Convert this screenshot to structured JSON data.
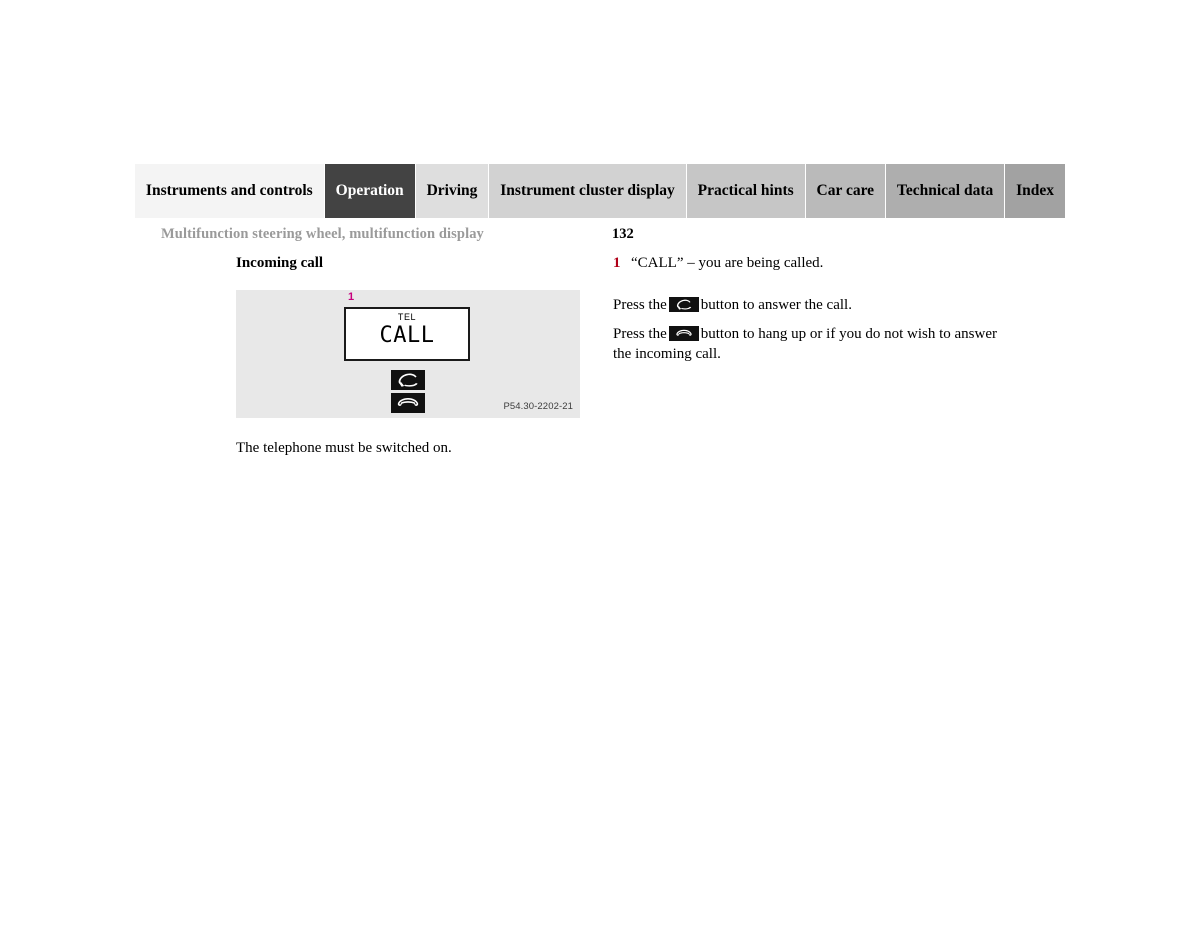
{
  "tabbar": {
    "tabs": [
      {
        "label": "Instruments and controls",
        "active": false,
        "bg": "#f4f4f4",
        "width": 117
      },
      {
        "label": "Operation",
        "active": true,
        "bg": "#434343",
        "width": 118
      },
      {
        "label": "Driving",
        "active": false,
        "bg": "#dedede",
        "width": 117
      },
      {
        "label": "Instrument cluster display",
        "active": false,
        "bg": "#d2d2d2",
        "width": 117
      },
      {
        "label": "Practical hints",
        "active": false,
        "bg": "#c6c6c6",
        "width": 117
      },
      {
        "label": "Car care",
        "active": false,
        "bg": "#bababa",
        "width": 117
      },
      {
        "label": "Technical data",
        "active": false,
        "bg": "#aeaeae",
        "width": 117
      },
      {
        "label": "Index",
        "active": false,
        "bg": "#a2a2a2",
        "width": 117
      }
    ]
  },
  "header": {
    "running_head": "Multifunction steering wheel, multifunction display",
    "page_number": "132"
  },
  "left_column": {
    "subheading": "Incoming call",
    "figure": {
      "callout_label": "1",
      "callout_color": "#c7007d",
      "display": {
        "mode_label": "TEL",
        "message": "CALL"
      },
      "buttons": [
        {
          "icon": "phone-answer-icon",
          "name": "answer-call-button"
        },
        {
          "icon": "phone-hangup-icon",
          "name": "hang-up-button"
        }
      ],
      "figure_code": "P54.30-2202-21"
    },
    "note": "The telephone must be switched on."
  },
  "right_column": {
    "numbered_items": [
      {
        "number": "1",
        "text": "“CALL” – you are being called."
      }
    ],
    "paragraphs": [
      {
        "before": "Press the",
        "icon": "phone-answer-icon",
        "after": "button to answer the call."
      },
      {
        "before": "Press the",
        "icon": "phone-hangup-icon",
        "after": "button to hang up or if you do not wish to answer the incoming call."
      }
    ]
  },
  "colors": {
    "callout_magenta": "#c7007d",
    "number_red": "#b00018",
    "running_head_gray": "#9a9a9a",
    "figure_bg": "#e8e8e8",
    "key_bg": "#111111"
  }
}
